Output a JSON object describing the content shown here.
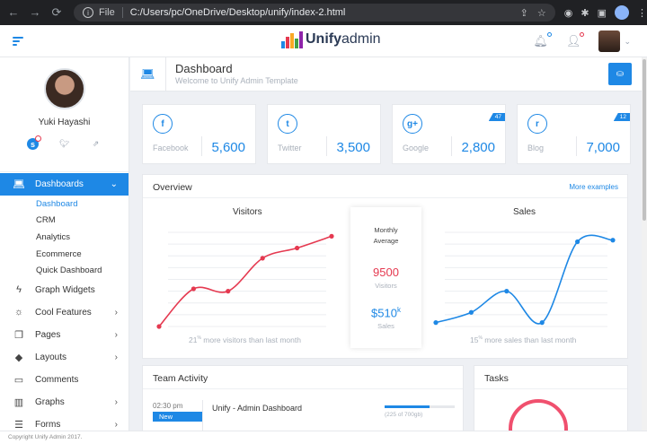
{
  "browser": {
    "file_label": "File",
    "url": "C:/Users/pc/OneDrive/Desktop/unify/index-2.html"
  },
  "header": {
    "logo_bold": "Unify",
    "logo_light": "admin",
    "logo_colors": [
      "#1e88e5",
      "#e53950",
      "#f9a825",
      "#43a047",
      "#8e24aa"
    ]
  },
  "sidebar": {
    "user_name": "Yuki Hayashi",
    "menu": [
      {
        "label": "Dashboards",
        "icon": "laptop-icon",
        "active": true,
        "expanded": true
      },
      {
        "label": "Graph Widgets",
        "icon": "lightning-icon"
      },
      {
        "label": "Cool Features",
        "icon": "sun-icon"
      },
      {
        "label": "Pages",
        "icon": "copy-icon"
      },
      {
        "label": "Layouts",
        "icon": "layers-icon"
      },
      {
        "label": "Comments",
        "icon": "comment-icon"
      },
      {
        "label": "Graphs",
        "icon": "chart-icon"
      },
      {
        "label": "Forms",
        "icon": "form-icon"
      }
    ],
    "submenu": [
      "Dashboard",
      "CRM",
      "Analytics",
      "Ecommerce",
      "Quick Dashboard"
    ]
  },
  "page": {
    "title": "Dashboard",
    "subtitle": "Welcome to Unify Admin Template"
  },
  "stats": [
    {
      "label": "Facebook",
      "value": "5,600",
      "icon": "facebook-icon",
      "glyph": "f"
    },
    {
      "label": "Twitter",
      "value": "3,500",
      "icon": "twitter-icon",
      "glyph": "t"
    },
    {
      "label": "Google",
      "value": "2,800",
      "icon": "google-plus-icon",
      "glyph": "g+",
      "badge": "47"
    },
    {
      "label": "Blog",
      "value": "7,000",
      "icon": "rss-icon",
      "glyph": "r",
      "badge": "12"
    }
  ],
  "overview": {
    "title": "Overview",
    "link": "More examples",
    "middle": {
      "label_line1": "Monthly",
      "label_line2": "Average",
      "visitors_value": "9500",
      "visitors_label": "Visitors",
      "sales_value": "$510",
      "sales_suffix": "k",
      "sales_label": "Sales"
    },
    "footer_left": {
      "num": "21",
      "sup": "%",
      "text": " more visitors than last month"
    },
    "footer_right": {
      "num": "15",
      "sup": "%",
      "text": " more sales than last month"
    }
  },
  "chart_data": [
    {
      "type": "line",
      "title": "Visitors",
      "x": [
        1,
        2,
        3,
        4,
        5,
        6
      ],
      "series": [
        {
          "values": [
            0,
            48,
            45,
            87,
            100,
            115
          ],
          "color": "#e53950"
        }
      ],
      "ylim": [
        0,
        120
      ],
      "grid": true
    },
    {
      "type": "line",
      "title": "Sales",
      "x": [
        1,
        2,
        3,
        4,
        5,
        6
      ],
      "series": [
        {
          "values": [
            5,
            18,
            45,
            5,
            108,
            110
          ],
          "color": "#1e88e5"
        }
      ],
      "ylim": [
        0,
        120
      ],
      "grid": true
    }
  ],
  "team": {
    "title": "Team Activity",
    "time": "02:30 pm",
    "badge": "New",
    "activity": "Unify - Admin Dashboard",
    "progress": 0.64,
    "progress_text": "(225 of 700gb)"
  },
  "tasks": {
    "title": "Tasks"
  },
  "footer": {
    "text": "Copyright Unify Admin 2017."
  }
}
